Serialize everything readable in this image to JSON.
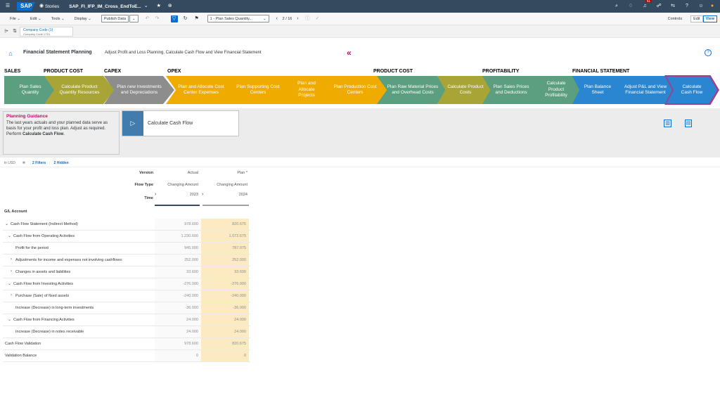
{
  "shell": {
    "logo": "SAP",
    "stories_label": "Stories",
    "story_name": "SAP_FI_IFP_IM_Cross_EndToE...",
    "notification_count": "51"
  },
  "menubar": {
    "file": "File",
    "edit": "Edit",
    "tools": "Tools",
    "display": "Display",
    "publish_data": "Publish Data",
    "dropdown_value": "1 - Plan Sales Quantity...",
    "page_counter": "2 / 16",
    "controls": "Controls",
    "mode_edit": "Edit",
    "mode_view": "View"
  },
  "filterbar": {
    "filter_title": "Company Code (1)",
    "filter_value": "Company Code 1710"
  },
  "header": {
    "title": "Financial Statement Planning",
    "subtitle": "Adjust Profit and Loss Planning, Calculate Cash Flow and View Financial Statement"
  },
  "process": {
    "group_labels": [
      {
        "label": "SALES"
      },
      {
        "label": "PRODUCT COST"
      },
      {
        "label": "CAPEX"
      },
      {
        "label": "OPEX"
      },
      {
        "label": "PRODUCT COST"
      },
      {
        "label": "PROFITABILITY"
      },
      {
        "label": "FINANCIAL STATEMENT"
      }
    ],
    "steps": [
      {
        "label": "Plan Sales Quantity",
        "color": "#5b9f80"
      },
      {
        "label": "Calculate Product Quantity Resources",
        "color": "#a8a536"
      },
      {
        "label": "Plan new Investments and Depreciations",
        "color": "#8d8d8d"
      },
      {
        "label": "Plan and Allocate Cost Center Expenses",
        "color": "#f0ab00"
      },
      {
        "label": "Plan Supporting Cost Centers",
        "color": "#f0ab00"
      },
      {
        "label": "Plan and Allocate Projects",
        "color": "#f0ab00"
      },
      {
        "label": "Plan Production Cost Centers",
        "color": "#f0ab00"
      },
      {
        "label": "Plan Raw Material Prices and Overhead Costs",
        "color": "#5b9f80"
      },
      {
        "label": "Calculate Product Costs",
        "color": "#a8a536"
      },
      {
        "label": "Plan Sales Prices and Deductions",
        "color": "#5b9f80"
      },
      {
        "label": "Calculate Product Profitability",
        "color": "#5b9f80"
      },
      {
        "label": "Plan Balance Sheet",
        "color": "#2b86d1"
      },
      {
        "label": "Adjust P&L and View Financial Statement",
        "color": "#2b86d1"
      },
      {
        "label": "Calculate Cash Flow",
        "color": "#2b86d1"
      }
    ]
  },
  "guidance": {
    "title": "Planning Guidance",
    "text_before": "The last years actuals and your planned data serve as basis for your profit and loss plan. Adjust as required. Perform",
    "text_bold": "Calculate Cash Flow",
    "text_after": "."
  },
  "task": {
    "label": "Calculate Cash Flow"
  },
  "tablebar": {
    "currency": "in USD",
    "filters": "2 Filters",
    "hidden": "2 Hidden"
  },
  "table": {
    "version_label": "Version",
    "version_values": [
      "Actual",
      "Plan *"
    ],
    "flowtype_label": "Flow Type",
    "flowtype_values": [
      "Changing Amount",
      "Changing Amount"
    ],
    "time_label": "Time",
    "time_values": [
      "2023",
      "2024"
    ],
    "account_header": "G/L Account",
    "rows": [
      {
        "label": "Cash Flow Statement (Indirect Method)",
        "actual": "978.600",
        "plan": "820.675"
      },
      {
        "label": "Cash Flow from Operating Activities",
        "actual": "1.230.600",
        "plan": "1.072.675"
      },
      {
        "label": "Profit for the period",
        "actual": "945.000",
        "plan": "787.075"
      },
      {
        "label": "Adjustments for income and expenses not involving cashflows:",
        "actual": "252.000",
        "plan": "252.000"
      },
      {
        "label": "Changes in assets and liabilities",
        "actual": "33.600",
        "plan": "33.600"
      },
      {
        "label": "Cash Flow from Investing Activities",
        "actual": "-276.000",
        "plan": "-276.000"
      },
      {
        "label": "Purchase (Sale) of fixed assets",
        "actual": "-240.000",
        "plan": "-240.000"
      },
      {
        "label": "Increase (Decrease) in long-term investments",
        "actual": "-36.000",
        "plan": "-36.000"
      },
      {
        "label": "Cash Flow from Financing Activities",
        "actual": "24.000",
        "plan": "24.000"
      },
      {
        "label": "Increase (Decrease) in notes receivable",
        "actual": "24.000",
        "plan": "24.000"
      },
      {
        "label": "Cash Flow Validation",
        "actual": "978.600",
        "plan": "820.675"
      },
      {
        "label": "Validation Balance",
        "actual": "0",
        "plan": "0"
      }
    ]
  }
}
